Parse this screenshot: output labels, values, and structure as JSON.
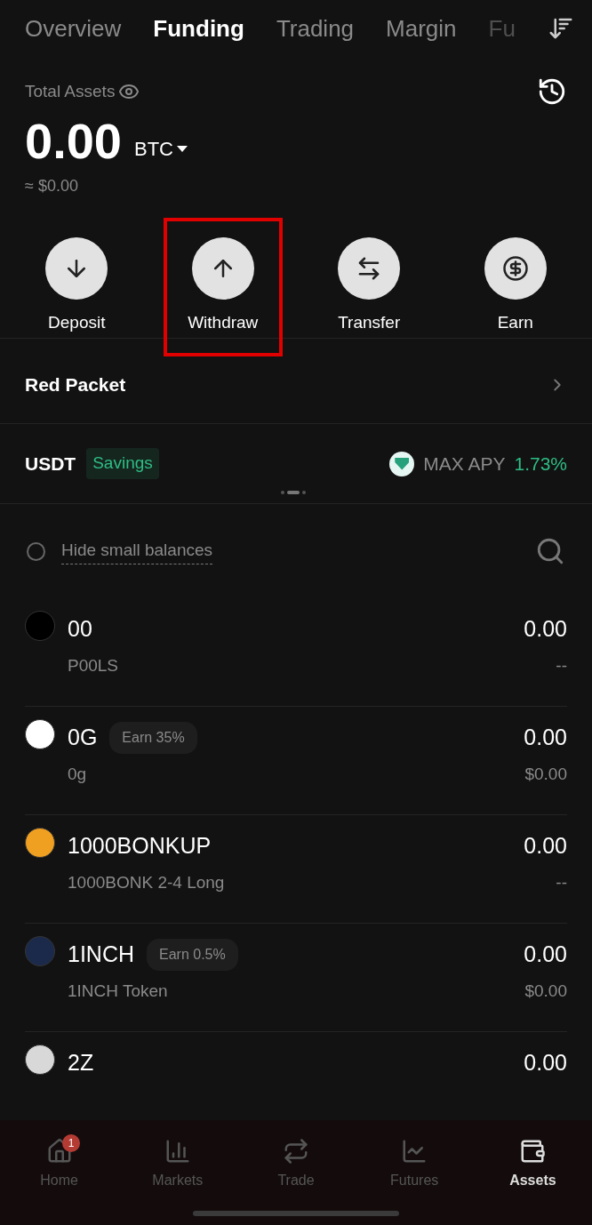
{
  "tabs": [
    {
      "label": "Overview",
      "selected": false
    },
    {
      "label": "Funding",
      "selected": true
    },
    {
      "label": "Trading",
      "selected": false
    },
    {
      "label": "Margin",
      "selected": false
    },
    {
      "label": "Fu",
      "selected": false
    }
  ],
  "summary": {
    "label": "Total Assets",
    "amount": "0.00",
    "currency": "BTC",
    "fiat": "≈ $0.00"
  },
  "actions": [
    {
      "kind": "deposit",
      "label": "Deposit",
      "highlighted": false
    },
    {
      "kind": "withdraw",
      "label": "Withdraw",
      "highlighted": true
    },
    {
      "kind": "transfer",
      "label": "Transfer",
      "highlighted": false
    },
    {
      "kind": "earn",
      "label": "Earn",
      "highlighted": false
    }
  ],
  "red_packet": {
    "label": "Red Packet"
  },
  "promo": {
    "coin": "USDT",
    "tag": "Savings",
    "apy_label": "MAX APY",
    "apy": "1.73%"
  },
  "filter": {
    "label": "Hide small balances",
    "checked": false
  },
  "assets": [
    {
      "symbol": "00",
      "name": "P00LS",
      "amount": "0.00",
      "value": "--",
      "color": "#000000"
    },
    {
      "symbol": "0G",
      "badge": "Earn 35%",
      "name": "0g",
      "amount": "0.00",
      "value": "$0.00",
      "color": "#ffffff"
    },
    {
      "symbol": "1000BONKUP",
      "name": "1000BONK 2-4 Long",
      "amount": "0.00",
      "value": "--",
      "color": "#f0a020"
    },
    {
      "symbol": "1INCH",
      "badge": "Earn 0.5%",
      "name": "1INCH Token",
      "amount": "0.00",
      "value": "$0.00",
      "color": "#1b2a4a"
    },
    {
      "symbol": "2Z",
      "amount": "0.00",
      "color": "#d8d8d8"
    }
  ],
  "nav": [
    {
      "kind": "home",
      "label": "Home",
      "badge": "1",
      "selected": false
    },
    {
      "kind": "markets",
      "label": "Markets",
      "selected": false
    },
    {
      "kind": "trade",
      "label": "Trade",
      "selected": false
    },
    {
      "kind": "futures",
      "label": "Futures",
      "selected": false
    },
    {
      "kind": "assets",
      "label": "Assets",
      "selected": true
    }
  ]
}
